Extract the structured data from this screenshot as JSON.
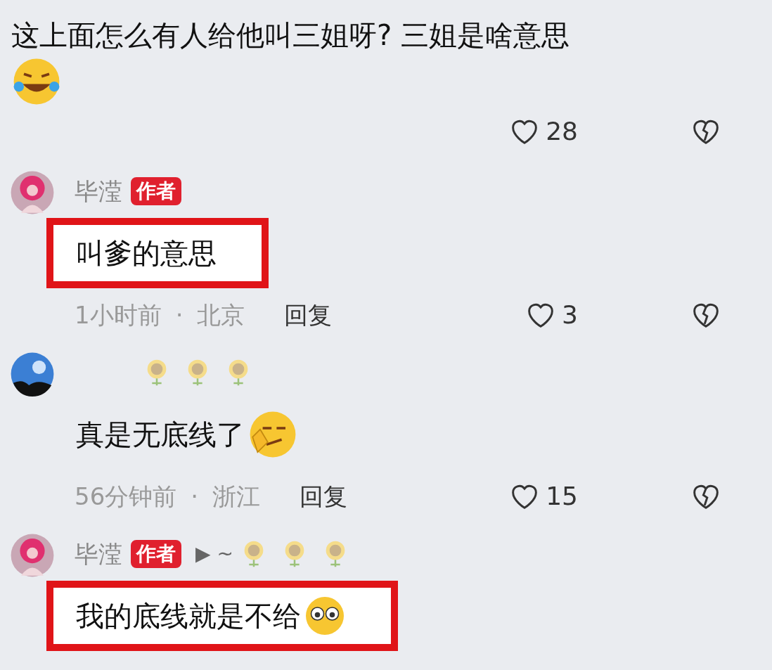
{
  "comments": [
    {
      "kind": "top",
      "text": "这上面怎么有人给他叫三姐呀? 三姐是啥意思",
      "emoji": {
        "kind": "laughing"
      },
      "likes": "28"
    },
    {
      "kind": "reply",
      "avatar": {
        "kind": "pink"
      },
      "name": "毕滢",
      "badge": "作者",
      "text": "叫爹的意思",
      "highlighted": true,
      "time": "1小时前",
      "separator": "·",
      "location": "北京",
      "reply": "回复",
      "likes": "3"
    },
    {
      "kind": "reply",
      "avatar": {
        "kind": "blue"
      },
      "name_icons": [
        {
          "kind": "sunflower"
        },
        {
          "kind": "sunflower"
        },
        {
          "kind": "sunflower"
        }
      ],
      "text": "真是无底线了",
      "emoji": {
        "kind": "smirk"
      },
      "highlighted": false,
      "time": "56分钟前",
      "separator": "·",
      "location": "浙江",
      "reply": "回复",
      "likes": "15"
    },
    {
      "kind": "reply",
      "avatar": {
        "kind": "pink"
      },
      "name": "毕滢",
      "badge": "作者",
      "extra": "▶ ~",
      "name_icons": [
        {
          "kind": "sunflower"
        },
        {
          "kind": "sunflower"
        },
        {
          "kind": "sunflower"
        }
      ],
      "text": "我的底线就是不给",
      "emoji": {
        "kind": "eyes"
      },
      "highlighted": true
    }
  ]
}
